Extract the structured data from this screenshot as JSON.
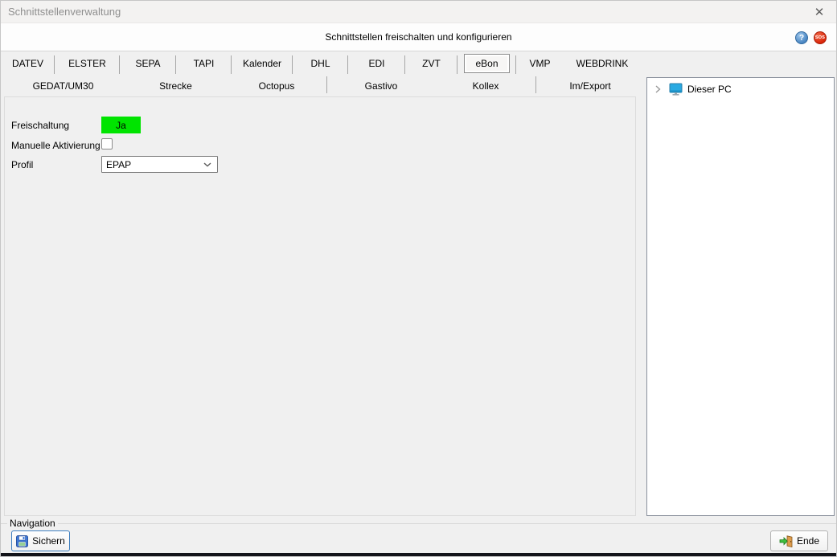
{
  "window": {
    "title": "Schnittstellenverwaltung"
  },
  "header": {
    "heading": "Schnittstellen freischalten und konfigurieren"
  },
  "icons": {
    "close_icon": "✕",
    "help_icon": "?",
    "sos_icon": "SOS",
    "save_icon": "floppy-disk",
    "end_icon": "exit-door",
    "pc_icon": "computer-monitor",
    "tree_expand_icon": "chevron-right",
    "dropdown_icon": "chevron-down"
  },
  "tabs": {
    "row1": [
      "DATEV",
      "ELSTER",
      "SEPA",
      "TAPI",
      "Kalender",
      "DHL",
      "EDI",
      "ZVT",
      "eBon",
      "VMP",
      "WEBDRINK"
    ],
    "row2": [
      "GEDAT/UM30",
      "Strecke",
      "Octopus",
      "Gastivo",
      "Kollex",
      "Im/Export"
    ],
    "selected": "eBon"
  },
  "form": {
    "freischaltung_label": "Freischaltung",
    "freischaltung_value": "Ja",
    "manuelle_label": "Manuelle Aktivierung",
    "manuelle_checked": false,
    "profil_label": "Profil",
    "profil_value": "EPAP"
  },
  "tree": {
    "root_label": "Dieser PC"
  },
  "footer": {
    "group_label": "Navigation",
    "save_label": "Sichern",
    "end_label": "Ende"
  },
  "colors": {
    "enabled_green": "#00e400",
    "sos_red": "#d92408",
    "help_blue": "#4a86c2",
    "focus_border_blue": "#3f7fbf",
    "background": "#f0f0f0"
  }
}
